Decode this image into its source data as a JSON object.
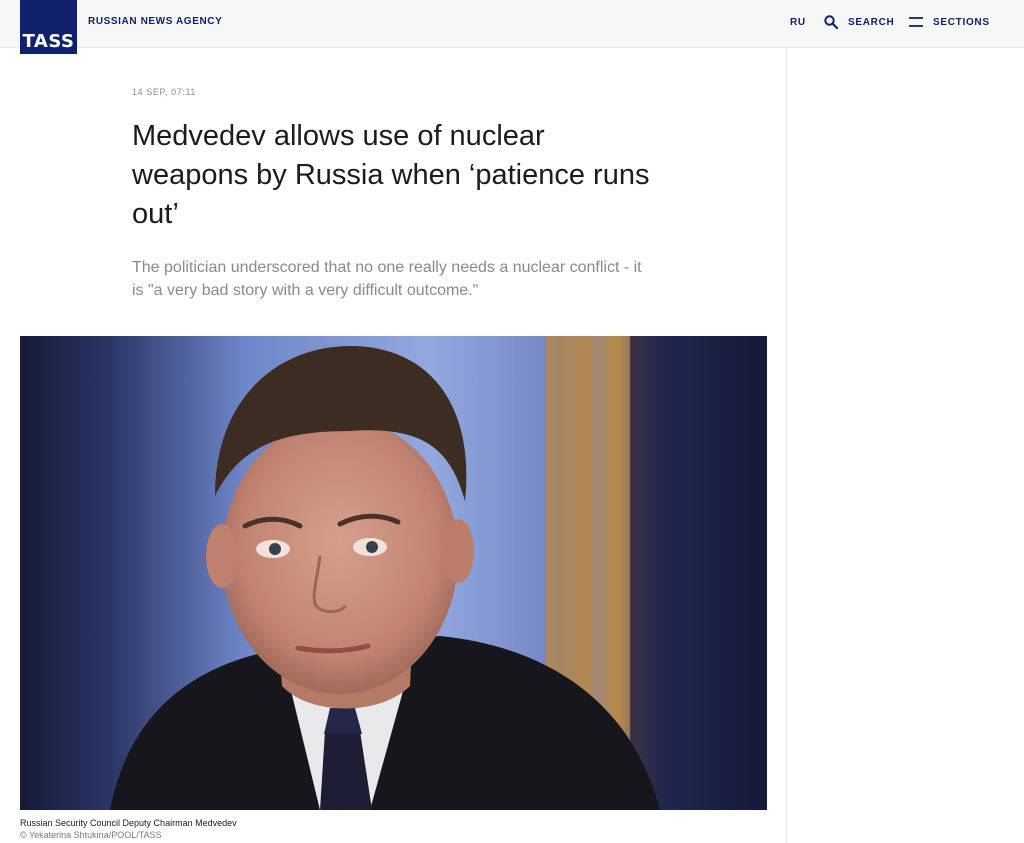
{
  "header": {
    "logo_text": "TASS",
    "agency_label": "RUSSIAN NEWS AGENCY",
    "lang_label": "RU",
    "search_label": "SEARCH",
    "sections_label": "SECTIONS",
    "brand_color": "#10226b"
  },
  "article": {
    "date": "14 SEP, 07:11",
    "headline": "Medvedev allows use of nuclear weapons by Russia when ‘patience runs out’",
    "lead": "The politician underscored that no one really needs a nuclear conflict - it is \"a very bad story with a very difficult outcome.\"",
    "photo": {
      "caption": "Russian Security Council Deputy Chairman Medvedev",
      "credit": "© Yekaterina Shtukina/POOL/TASS"
    }
  },
  "icons": {
    "search": "search-icon",
    "menu": "menu-icon"
  }
}
